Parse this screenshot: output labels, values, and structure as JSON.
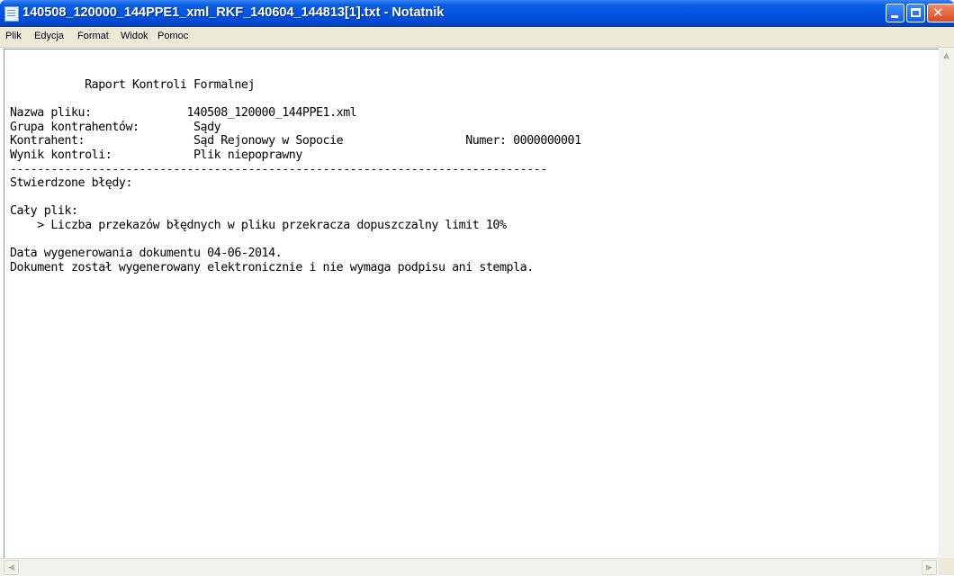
{
  "window": {
    "title": "140508_120000_144PPE1_xml_RKF_140604_144813[1].txt - Notatnik",
    "app_icon": "notepad-icon",
    "accent": "#0054e3",
    "close_color": "#e25a32"
  },
  "menu": {
    "items": [
      {
        "label": "Plik"
      },
      {
        "label": "Edycja"
      },
      {
        "label": "Format"
      },
      {
        "label": "Widok"
      },
      {
        "label": "Pomoc"
      }
    ]
  },
  "document": {
    "text": "           Raport Kontroli Formalnej\n\nNazwa pliku:              140508_120000_144PPE1.xml\nGrupa kontrahentów:        Sądy\nKontrahent:                Sąd Rejonowy w Sopocie                  Numer: 0000000001\nWynik kontroli:            Plik niepoprawny\n-------------------------------------------------------------------------------\nStwierdzone błędy:\n\nCały plik:\n    > Liczba przekazów błędnych w pliku przekracza dopuszczalny limit 10%\n\nData wygenerowania dokumentu 04-06-2014.\nDokument został wygenerowany elektronicznie i nie wymaga podpisu ani stempla."
  }
}
